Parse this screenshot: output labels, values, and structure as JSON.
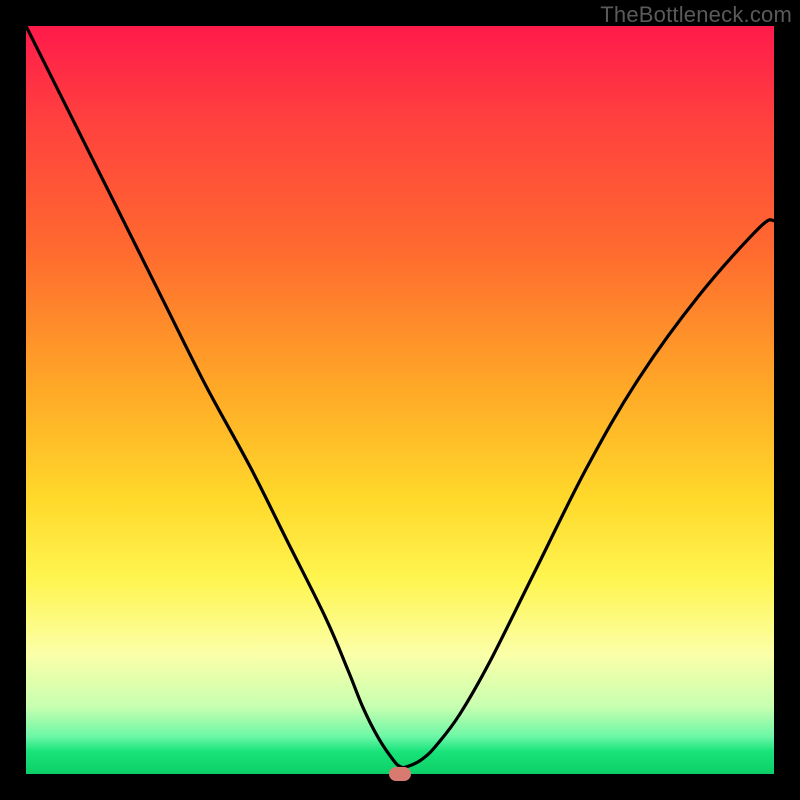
{
  "watermark": "TheBottleneck.com",
  "colors": {
    "frame": "#000000",
    "curve": "#000000",
    "marker": "#d87a6f",
    "gradient_top": "#ff1a4b",
    "gradient_bottom": "#0bcf66"
  },
  "chart_data": {
    "type": "line",
    "title": "",
    "xlabel": "",
    "ylabel": "",
    "xlim": [
      0,
      100
    ],
    "ylim": [
      0,
      100
    ],
    "grid": false,
    "legend": false,
    "series": [
      {
        "name": "bottleneck-curve",
        "x": [
          0,
          6,
          12,
          18,
          24,
          30,
          35,
          40,
          43,
          45,
          47,
          49,
          50,
          51,
          53,
          55,
          58,
          62,
          68,
          75,
          82,
          90,
          98,
          100
        ],
        "values": [
          100,
          88,
          76,
          64,
          52,
          41,
          31,
          21,
          14,
          9,
          5,
          2,
          1,
          1,
          2,
          4,
          8,
          15,
          27,
          41,
          53,
          64,
          73,
          74
        ]
      }
    ],
    "marker": {
      "x": 50,
      "y": 0
    },
    "background_gradient_meaning": "top = high bottleneck (bad / red), bottom = balanced (good / green)"
  }
}
